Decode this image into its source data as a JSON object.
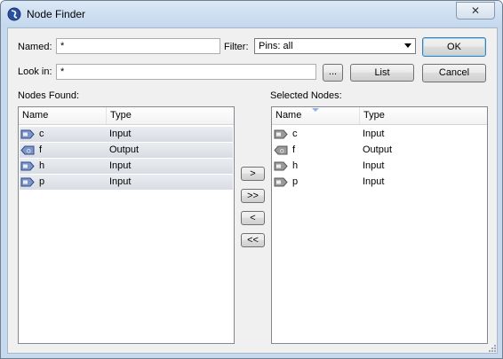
{
  "window": {
    "title": "Node Finder",
    "close_glyph": "✕"
  },
  "named": {
    "label": "Named:",
    "value": "*"
  },
  "filter": {
    "label": "Filter:",
    "value": "Pins: all"
  },
  "look_in": {
    "label": "Look in:",
    "value": "*",
    "browse_label": "..."
  },
  "buttons": {
    "ok": "OK",
    "list": "List",
    "cancel": "Cancel"
  },
  "transfer": {
    "add": ">",
    "add_all": ">>",
    "remove": "<",
    "remove_all": "<<"
  },
  "nodes_found": {
    "label": "Nodes Found:",
    "columns": [
      "Name",
      "Type"
    ],
    "rows": [
      {
        "name": "c",
        "type": "Input",
        "icon": "input-pin-icon"
      },
      {
        "name": "f",
        "type": "Output",
        "icon": "output-pin-icon"
      },
      {
        "name": "h",
        "type": "Input",
        "icon": "input-pin-icon"
      },
      {
        "name": "p",
        "type": "Input",
        "icon": "input-pin-icon"
      }
    ]
  },
  "selected_nodes": {
    "label": "Selected Nodes:",
    "columns": [
      "Name",
      "Type"
    ],
    "rows": [
      {
        "name": "c",
        "type": "Input",
        "icon": "input-pin-icon"
      },
      {
        "name": "f",
        "type": "Output",
        "icon": "output-pin-icon"
      },
      {
        "name": "h",
        "type": "Input",
        "icon": "input-pin-icon"
      },
      {
        "name": "p",
        "type": "Input",
        "icon": "input-pin-icon"
      }
    ]
  },
  "colors": {
    "titlebar": "#c6d9ee",
    "selected_row": "#dde1e6",
    "default_button_border": "#3c7fb1"
  }
}
